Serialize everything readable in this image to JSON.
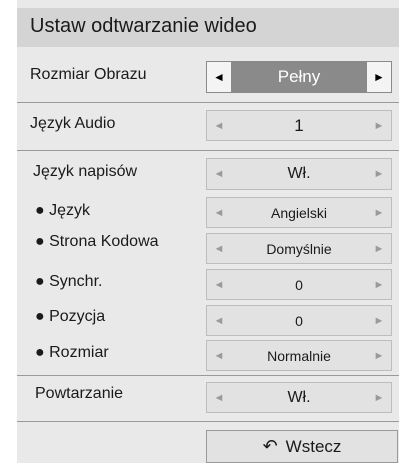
{
  "title": "Ustaw odtwarzanie wideo",
  "rows": {
    "rozmiar_obrazu": {
      "label": "Rozmiar Obrazu",
      "value": "Pełny"
    },
    "jezyk_audio": {
      "label": "Język Audio",
      "value": "1"
    },
    "jezyk_napisow": {
      "label": "Język napisów",
      "value": "Wł."
    },
    "jezyk": {
      "label": "● Język",
      "value": "Angielski"
    },
    "strona_kodowa": {
      "label": "● Strona Kodowa",
      "value": "Domyślnie"
    },
    "synchr": {
      "label": "● Synchr.",
      "value": "0"
    },
    "pozycja": {
      "label": "● Pozycja",
      "value": "0"
    },
    "rozmiar": {
      "label": "● Rozmiar",
      "value": "Normalnie"
    },
    "powtarzanie": {
      "label": "Powtarzanie",
      "value": "Wł."
    }
  },
  "arrows": {
    "left": "◄",
    "right": "►"
  },
  "back": {
    "icon": "↶",
    "label": "Wstecz"
  },
  "colors": {
    "panel": "#e9e9e9",
    "title_bar": "#d4d4d4",
    "active_value": "#8a8a8a"
  }
}
